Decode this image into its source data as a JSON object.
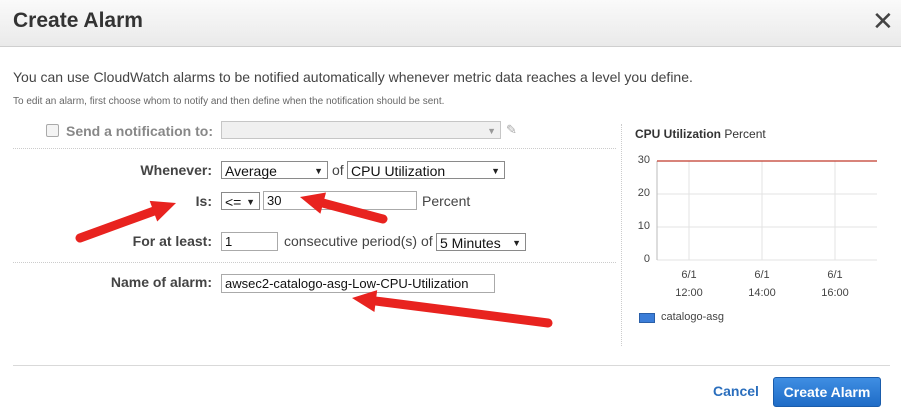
{
  "dialog": {
    "title": "Create Alarm",
    "close_glyph": "✕",
    "intro": "You can use CloudWatch alarms to be notified automatically whenever metric data reaches a level you define.",
    "subintro": "To edit an alarm, first choose whom to notify and then define when the notification should be sent."
  },
  "form": {
    "notify_label": "Send a notification to:",
    "notify_value": "",
    "whenever_label": "Whenever:",
    "statistic": "Average",
    "of_text": "of",
    "metric": "CPU Utilization",
    "is_label": "Is:",
    "operator": "<=",
    "threshold": "30",
    "unit": "Percent",
    "for_at_least_label": "For at least:",
    "periods": "1",
    "periods_text": "consecutive period(s) of",
    "period_length": "5 Minutes",
    "name_label": "Name of alarm:",
    "alarm_name": "awsec2-catalogo-asg-Low-CPU-Utilization"
  },
  "chart_data": {
    "type": "line",
    "title": "CPU Utilization",
    "title_unit": "Percent",
    "y_ticks": [
      "30",
      "20",
      "10",
      "0"
    ],
    "ylim": [
      0,
      30
    ],
    "x_ticks": [
      {
        "date": "6/1",
        "time": "12:00"
      },
      {
        "date": "6/1",
        "time": "14:00"
      },
      {
        "date": "6/1",
        "time": "16:00"
      }
    ],
    "threshold": 30,
    "threshold_color": "#c0392b",
    "series": [
      {
        "name": "catalogo-asg",
        "values": [],
        "color": "#3b7dd8"
      }
    ]
  },
  "footer": {
    "cancel_label": "Cancel",
    "create_label": "Create Alarm"
  },
  "annotations": {
    "arrow_color": "#e8231f"
  }
}
